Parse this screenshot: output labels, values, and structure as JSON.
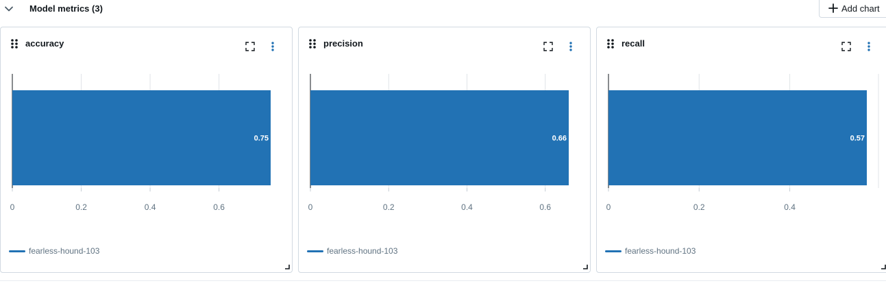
{
  "section": {
    "title": "Model metrics (3)",
    "add_chart_label": "Add chart",
    "collapse_icon": "chevron-down-icon",
    "add_icon": "plus-icon"
  },
  "colors": {
    "bar": "#2272b4",
    "grid": "#e0e4e8",
    "axis": "#11171c",
    "tick_text": "#5f7281"
  },
  "icons": {
    "drag": "drag-handle-icon",
    "expand": "fullscreen-icon",
    "menu": "overflow-menu-icon",
    "resize": "resize-handle-icon"
  },
  "cards": [
    {
      "title": "accuracy",
      "legend": "fearless-hound-103",
      "chart_data": {
        "type": "bar",
        "orientation": "horizontal",
        "series": [
          {
            "name": "fearless-hound-103",
            "values": [
              0.75
            ]
          }
        ],
        "value_labels": [
          "0.75"
        ],
        "xticks": [
          "0",
          "0.2",
          "0.4",
          "0.6"
        ],
        "xlim": [
          0,
          0.75
        ]
      }
    },
    {
      "title": "precision",
      "legend": "fearless-hound-103",
      "chart_data": {
        "type": "bar",
        "orientation": "horizontal",
        "series": [
          {
            "name": "fearless-hound-103",
            "values": [
              0.66
            ]
          }
        ],
        "value_labels": [
          "0.66"
        ],
        "xticks": [
          "0",
          "0.2",
          "0.4",
          "0.6"
        ],
        "xlim": [
          0,
          0.66
        ]
      }
    },
    {
      "title": "recall",
      "legend": "fearless-hound-103",
      "chart_data": {
        "type": "bar",
        "orientation": "horizontal",
        "series": [
          {
            "name": "fearless-hound-103",
            "values": [
              0.57
            ]
          }
        ],
        "value_labels": [
          "0.57"
        ],
        "xticks": [
          "0",
          "0.2",
          "0.4"
        ],
        "xlim": [
          0,
          0.57
        ]
      }
    }
  ]
}
